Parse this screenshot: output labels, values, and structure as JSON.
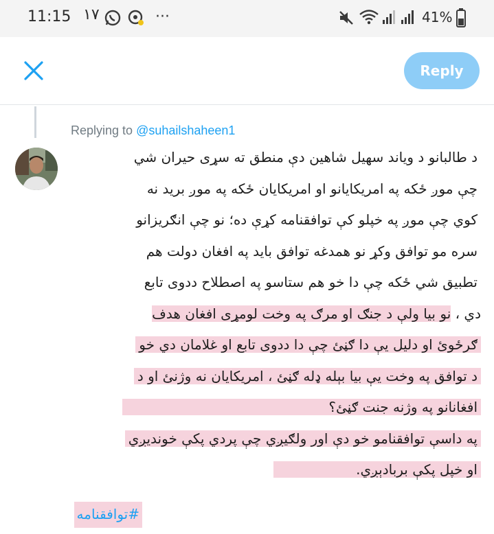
{
  "status_bar": {
    "time": "11:15",
    "notification_count": "١٧",
    "more": "···",
    "battery": "41%",
    "icons": [
      "whatsapp-icon",
      "app-icon",
      "mute-icon",
      "wifi-icon",
      "signal-icon",
      "signal-icon",
      "battery-icon"
    ]
  },
  "header": {
    "close_icon": "close-icon",
    "reply_label": "Reply"
  },
  "reply": {
    "replying_prefix": "Replying to ",
    "replying_handle": "@suhailshaheen1",
    "lines": [
      "د طالبانو د وياند سهيل شاهين دې منطق ته سړی حيران شي",
      "چې موږ ځکه په امريکايانو او امريکايان ځکه په موږ بريد نه",
      "کوي چې موږ په خپلو کې توافقنامه کړې ده؛ نو چې انګريزانو",
      "سره مو توافق وکړ نو همدغه توافق بايد په افغان دولت هم",
      "تطبيق شي ځکه چې دا خو هم ستاسو په اصطلاح ددوی تابع",
      "دي ، نو بيا ولې د جنګ او مرګ په وخت لومړی افغان هدف",
      "ګرځوئ او دليل يې دا ګڼئ چې دا ددوی تابع او غلامان دي خو",
      "د توافق په وخت يې بيا بېله ډله ګڼئ ، امريکايان نه وژنئ او د",
      "افغانانو په وژنه جنت ګڼئ؟",
      "په داسې توافقنامو خو دې اور ولګيږي چې پردي پکې خونديږي",
      "او خپل پکې بربادېږي."
    ],
    "hashtag": "#توافقنامه"
  }
}
